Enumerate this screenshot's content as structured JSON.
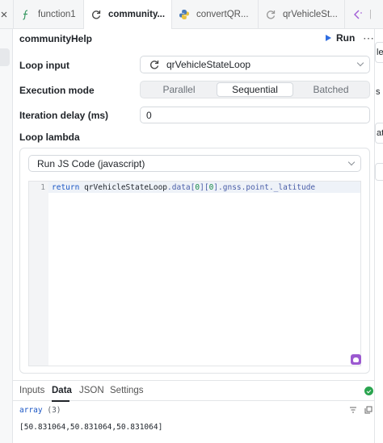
{
  "tabs": [
    {
      "label": "function1",
      "icon": "function-icon",
      "active": false
    },
    {
      "label": "community...",
      "icon": "loop-icon",
      "active": true
    },
    {
      "label": "convertQR...",
      "icon": "python-icon",
      "active": false
    },
    {
      "label": "qrVehicleSt...",
      "icon": "loop-icon",
      "active": false
    }
  ],
  "panel": {
    "title": "communityHelp",
    "run_label": "Run"
  },
  "form": {
    "loop_input_label": "Loop input",
    "loop_input_value": "qrVehicleStateLoop",
    "execution_mode_label": "Execution mode",
    "modes": [
      "Parallel",
      "Sequential",
      "Batched"
    ],
    "selected_mode": "Sequential",
    "iteration_delay_label": "Iteration delay (ms)",
    "iteration_delay_value": "0",
    "loop_lambda_label": "Loop lambda",
    "language_value": "Run JS Code (javascript)"
  },
  "editor": {
    "line_number": "1",
    "code": {
      "kw": "return",
      "obj": "qrVehicleStateLoop",
      "dot1": ".",
      "data": "data",
      "b1": "[",
      "i1": "0",
      "b2": "][",
      "i2": "0",
      "b3": "].",
      "path": "gnss.point._latitude"
    }
  },
  "result": {
    "tabs": [
      "Inputs",
      "Data",
      "JSON",
      "Settings"
    ],
    "active_tab": "Data",
    "type_label": "array",
    "count_label": "(3)",
    "value": "[50.831064,50.831064,50.831064]"
  },
  "right_strip": {
    "fragments": [
      "le",
      "s",
      "at"
    ]
  },
  "colors": {
    "accent": "#2f6de1",
    "success": "#2aa44f",
    "ai_badge": "#9b59d0"
  }
}
